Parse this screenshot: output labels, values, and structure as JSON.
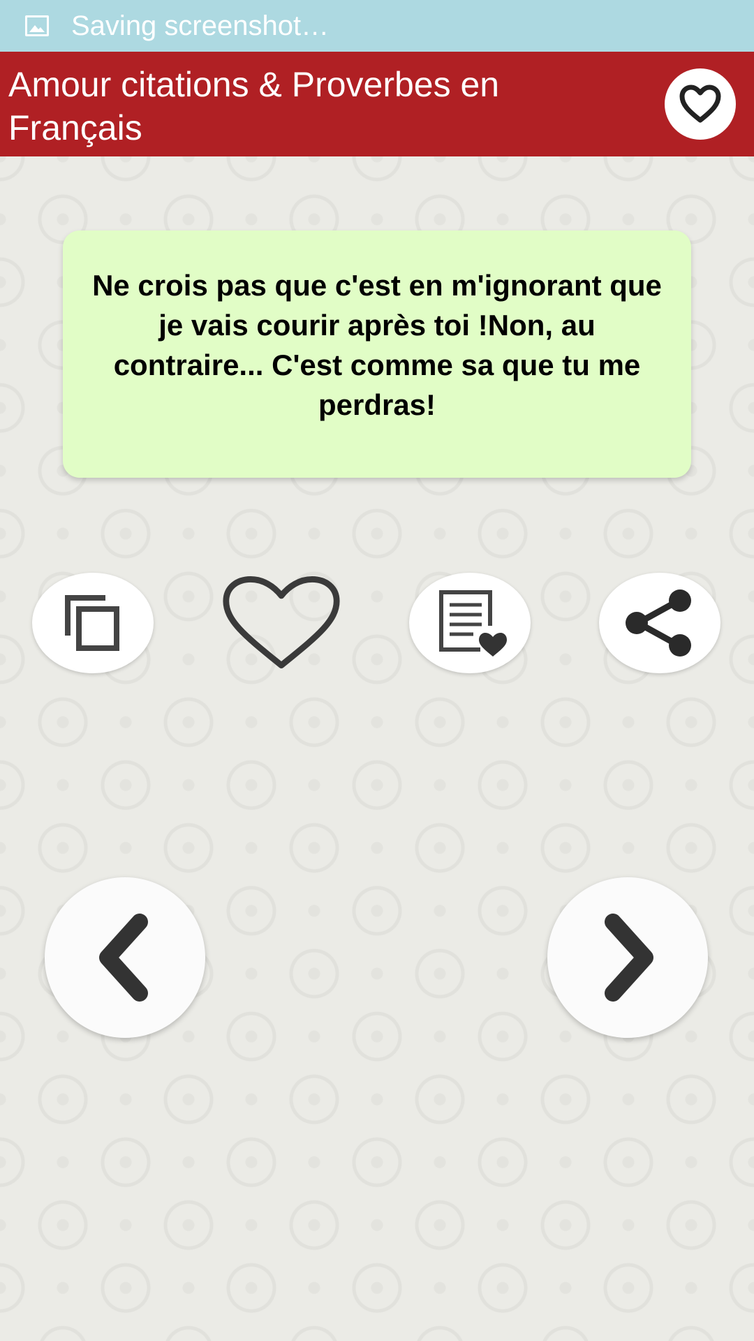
{
  "status_bar": {
    "text": "Saving screenshot…",
    "icon": "image-icon",
    "color": "#add9e1"
  },
  "app_bar": {
    "title": "Amour citations & Proverbes en Français",
    "favorites_icon": "heart-outline-icon",
    "color": "#b02024"
  },
  "quote": {
    "text": "Ne crois pas que c'est en m'ignorant que je vais courir après toi !Non, au contraire... C'est comme sa que tu me perdras!",
    "card_color": "#e1fdc6"
  },
  "actions": [
    {
      "name": "copy",
      "icon": "copy-icon"
    },
    {
      "name": "favorite",
      "icon": "heart-outline-icon"
    },
    {
      "name": "favorites-list",
      "icon": "note-heart-icon"
    },
    {
      "name": "share",
      "icon": "share-icon"
    }
  ],
  "navigation": {
    "previous_icon": "chevron-left-icon",
    "next_icon": "chevron-right-icon"
  }
}
